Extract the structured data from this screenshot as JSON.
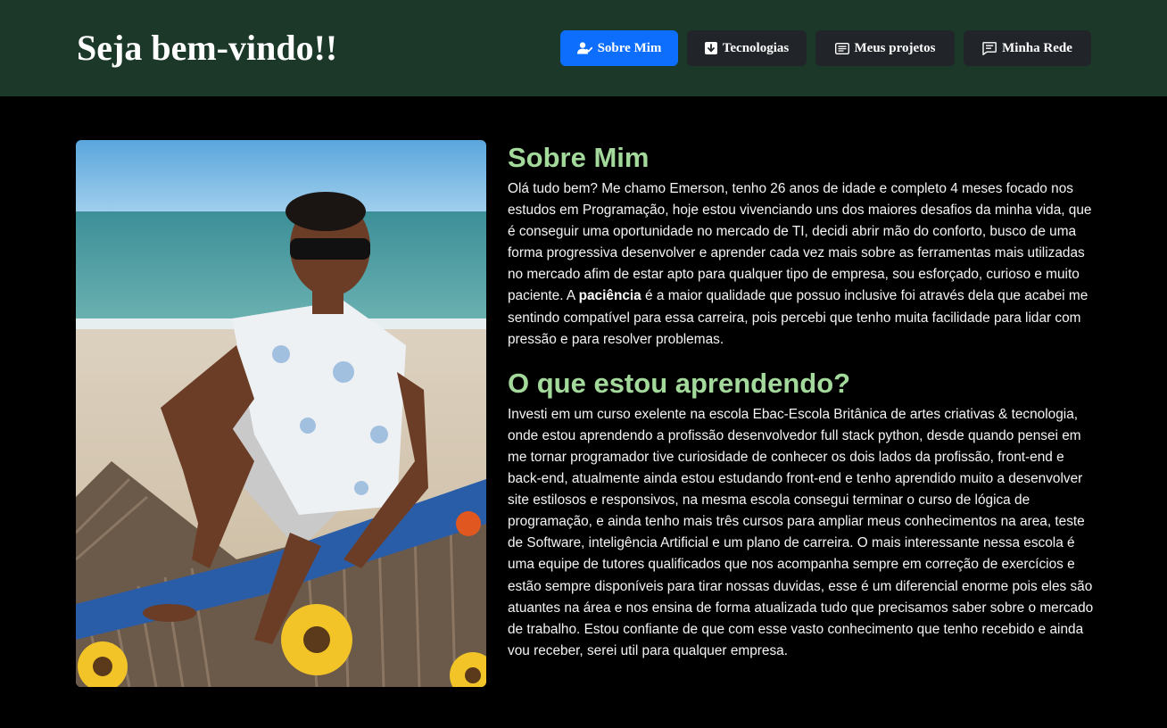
{
  "header": {
    "title": "Seja bem-vindo!!",
    "background_color": "#1b3829"
  },
  "nav": {
    "items": [
      {
        "label": "Sobre Mim",
        "icon": "user-check-icon",
        "active": true
      },
      {
        "label": "Tecnologias",
        "icon": "download-icon",
        "active": false
      },
      {
        "label": "Meus projetos",
        "icon": "card-text-icon",
        "active": false
      },
      {
        "label": "Minha Rede",
        "icon": "chat-left-text-icon",
        "active": false
      }
    ],
    "active_color": "#0d6efd",
    "inactive_color": "#212529"
  },
  "profile_photo": {
    "subject": "man in sunglasses sitting on beach seat"
  },
  "about": {
    "heading": "Sobre Mim",
    "text_before": "Olá tudo bem? Me chamo Emerson, tenho 26 anos de idade e completo 4 meses focado nos estudos em Programação, hoje estou vivenciando uns dos maiores desafios da minha vida, que é conseguir uma oportunidade no mercado de TI, decidi abrir mão do conforto, busco de uma forma progressiva desenvolver e aprender cada vez mais sobre as ferramentas mais utilizadas no mercado afim de estar apto para qualquer tipo de empresa, sou esforçado, curioso e muito paciente. A ",
    "text_bold": "paciência",
    "text_after": " é a maior qualidade que possuo inclusive foi através dela que acabei me sentindo compatível para essa carreira, pois percebi que tenho muita facilidade para lidar com pressão e para resolver problemas."
  },
  "learning": {
    "heading": "O que estou aprendendo?",
    "text": "Investi em um curso exelente na escola Ebac-Escola Britânica de artes criativas & tecnologia, onde estou aprendendo a profissão desenvolvedor full stack python, desde quando pensei em me tornar programador tive curiosidade de conhecer os dois lados da profissão, front-end e back-end, atualmente ainda estou estudando front-end e tenho aprendido muito a desenvolver site estilosos e responsivos, na mesma escola consegui terminar o curso de lógica de programação, e ainda tenho mais três cursos para ampliar meus conhecimentos na area, teste de Software, inteligência Artificial e um plano de carreira. O mais interessante nessa escola é uma equipe de tutores qualificados que nos acompanha sempre em correção de exercícios e estão sempre disponíveis para tirar nossas duvidas, esse é um diferencial enorme pois eles são atuantes na área e nos ensina de forma atualizada tudo que precisamos saber sobre o mercado de trabalho. Estou confiante de que com esse vasto conhecimento que tenho recebido e ainda vou receber, serei util para qualquer empresa."
  },
  "colors": {
    "heading_green": "#a3d99b",
    "page_background": "#000000"
  }
}
